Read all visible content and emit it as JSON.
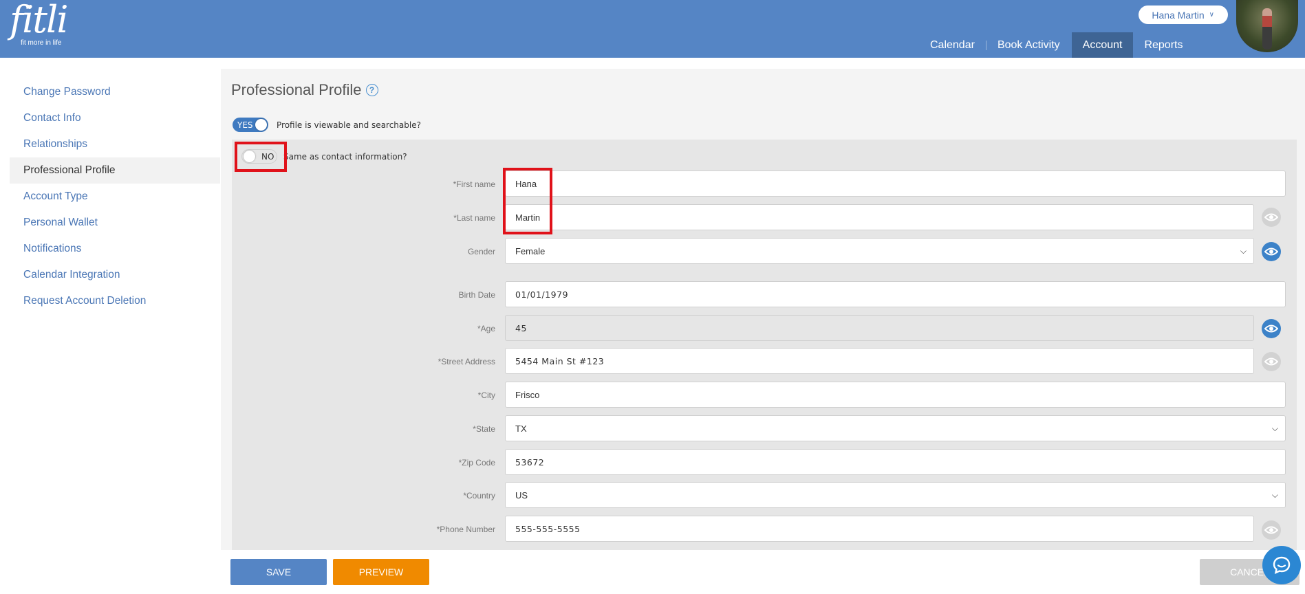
{
  "brand": {
    "name": "fitli",
    "tagline": "fit more in life"
  },
  "header": {
    "user_name": "Hana Martin",
    "nav": [
      {
        "label": "Calendar"
      },
      {
        "label": "Book Activity"
      },
      {
        "label": "Account",
        "active": true
      },
      {
        "label": "Reports"
      }
    ]
  },
  "sidebar": {
    "items": [
      {
        "label": "Change Password"
      },
      {
        "label": "Contact Info"
      },
      {
        "label": "Relationships"
      },
      {
        "label": "Professional Profile",
        "active": true
      },
      {
        "label": "Account Type"
      },
      {
        "label": "Personal Wallet"
      },
      {
        "label": "Notifications"
      },
      {
        "label": "Calendar Integration"
      },
      {
        "label": "Request Account Deletion"
      }
    ]
  },
  "main": {
    "title": "Professional Profile",
    "viewable_toggle": {
      "state": "YES",
      "label": "Profile is viewable and searchable?"
    },
    "same_contact_toggle": {
      "state": "NO",
      "label": "Same as contact information?"
    },
    "fields": {
      "first_name": {
        "label": "*First name",
        "value": "Hana"
      },
      "last_name": {
        "label": "*Last name",
        "value": "Martin"
      },
      "gender": {
        "label": "Gender",
        "value": "Female"
      },
      "birth_date": {
        "label": "Birth Date",
        "value": "01/01/1979"
      },
      "age": {
        "label": "*Age",
        "value": "45"
      },
      "street": {
        "label": "*Street Address",
        "value": "5454 Main St #123"
      },
      "city": {
        "label": "*City",
        "value": "Frisco"
      },
      "state": {
        "label": "*State",
        "value": "TX"
      },
      "zip": {
        "label": "*Zip Code",
        "value": "53672"
      },
      "country": {
        "label": "*Country",
        "value": "US"
      },
      "phone": {
        "label": "*Phone Number",
        "value": "555-555-5555"
      }
    }
  },
  "footer": {
    "save": "SAVE",
    "preview": "PREVIEW",
    "cancel": "CANCEL"
  },
  "colors": {
    "header": "#5585c5",
    "nav_active": "#3e6494",
    "link": "#4a76b5",
    "preview_button": "#f08a00",
    "highlight": "#e0121a",
    "eye_on": "#3c82c8",
    "eye_off": "#d2d2d2"
  }
}
